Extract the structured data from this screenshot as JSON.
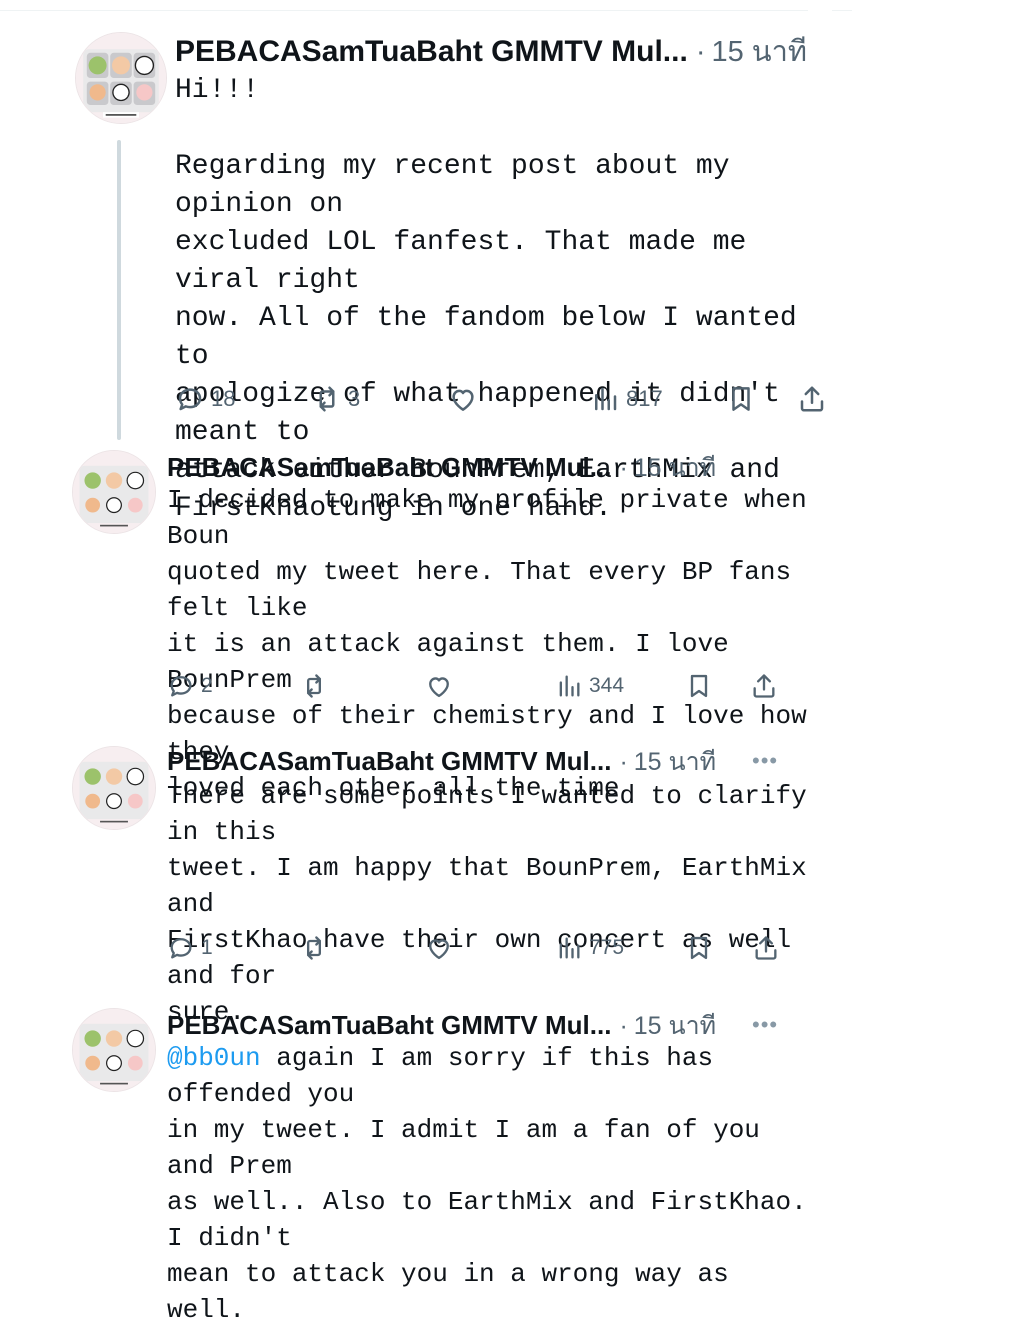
{
  "tweets": [
    {
      "name": "PEBACASamTuaBaht GMMTV Mul...",
      "time": "15 นาที",
      "lines": [
        "Hi!!!",
        "",
        "Regarding my recent post about my opinion on",
        "excluded LOL fanfest. That made me viral right",
        "now. All of the fandom below I wanted to",
        "apologize of what happened it didn't meant to",
        "attack either BounPrem, EarthMix and",
        "FirstKhaotung in one hand."
      ],
      "replies": "18",
      "reposts": "3",
      "likes": "",
      "views": "817"
    },
    {
      "name": "PEBACASamTuaBaht GMMTV Mul...",
      "time": "15 นาที",
      "lines": [
        "I decided to make my profile private when Boun",
        "quoted my tweet here. That every BP fans felt like",
        "it is an attack against them. I love BounPrem",
        "because of their chemistry and I love how they",
        "loved each other all the time"
      ],
      "replies": "2",
      "reposts": "",
      "likes": "",
      "views": "344"
    },
    {
      "name": "PEBACASamTuaBaht GMMTV Mul...",
      "time": "15 นาที",
      "more": "•••",
      "lines": [
        "There are some points I wanted to clarify in this",
        "tweet. I am happy that BounPrem, EarthMix and",
        "FirstKhao have their own concert as well and for",
        "sure."
      ],
      "replies": "1",
      "reposts": "",
      "likes": "",
      "views": "775"
    },
    {
      "name": "PEBACASamTuaBaht GMMTV Mul...",
      "time": "15 นาที",
      "more": "•••",
      "mention": "@bb0un",
      "lines": [
        " again I am sorry if this has offended you",
        "in my tweet. I admit I am a fan of you and Prem",
        "as well.. Also to EarthMix and FirstKhao. I didn't",
        "mean to attack you in a wrong way as well."
      ]
    }
  ],
  "separator": "·",
  "colors": {
    "text": "#0f1419",
    "meta": "#536471",
    "link": "#1d9bf0",
    "thread": "#cfd9de"
  },
  "icons": [
    "reply-icon",
    "repost-icon",
    "like-icon",
    "views-icon",
    "bookmark-icon",
    "share-icon",
    "more-icon"
  ]
}
